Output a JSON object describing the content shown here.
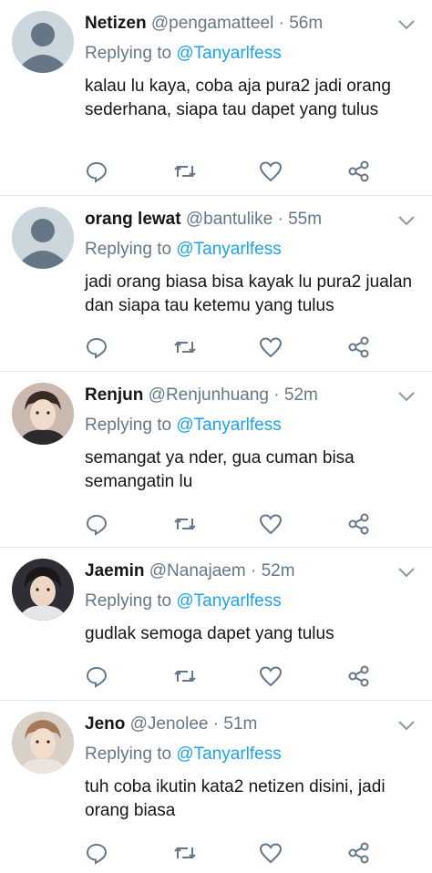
{
  "tweets": [
    {
      "name": "Netizen",
      "handle": "@pengamatteel",
      "dot": "·",
      "time": "56m",
      "reply_prefix": "Replying to",
      "reply_to": "@Tanyarlfess",
      "text": "kalau lu kaya,  coba aja pura2 jadi orang sederhana, siapa tau dapet yang tulus",
      "avatar": "default-avatar"
    },
    {
      "name": "orang lewat",
      "handle": "@bantulike",
      "dot": "·",
      "time": "55m",
      "reply_prefix": "Replying to",
      "reply_to": "@Tanyarlfess",
      "text": "jadi orang biasa bisa kayak lu pura2 jualan dan siapa tau ketemu yang tulus",
      "avatar": "default-avatar"
    },
    {
      "name": "Renjun",
      "handle": "@Renjunhuang",
      "dot": "·",
      "time": "52m",
      "reply_prefix": "Replying to",
      "reply_to": "@Tanyarlfess",
      "text": "semangat ya nder,  gua cuman bisa semangatin lu",
      "avatar": "photo-avatar"
    },
    {
      "name": "Jaemin",
      "handle": "@Nanajaem",
      "dot": "·",
      "time": "52m",
      "reply_prefix": "Replying to",
      "reply_to": "@Tanyarlfess",
      "text": "gudlak semoga dapet yang tulus",
      "avatar": "photo-avatar"
    },
    {
      "name": "Jeno",
      "handle": "@Jenolee",
      "dot": "·",
      "time": "51m",
      "reply_prefix": "Replying to",
      "reply_to": "@Tanyarlfess",
      "text": "tuh coba ikutin kata2 netizen disini, jadi orang biasa",
      "avatar": "photo-avatar"
    }
  ],
  "icons": {
    "reply": "reply-icon",
    "retweet": "retweet-icon",
    "like": "heart-icon",
    "share": "share-icon",
    "menu": "chevron-down-icon"
  },
  "colors": {
    "link": "#1da1f2",
    "secondary_text": "#657786",
    "primary_text": "#14171a",
    "divider": "#e1e8ed"
  }
}
